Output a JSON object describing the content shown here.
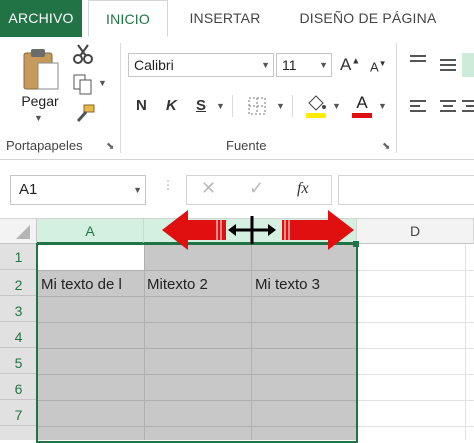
{
  "tabs": {
    "file": "ARCHIVO",
    "home": "INICIO",
    "insert": "INSERTAR",
    "page_layout": "DISEÑO DE PÁGINA"
  },
  "clipboard": {
    "paste_label": "Pegar",
    "group_label": "Portapapeles"
  },
  "font": {
    "name": "Calibri",
    "size": "11",
    "bold": "N",
    "italic": "K",
    "underline": "S",
    "grow": "A",
    "shrink": "A",
    "color_letter": "A",
    "group_label": "Fuente"
  },
  "formula_bar": {
    "name_box": "A1",
    "fx": "fx",
    "value": ""
  },
  "grid": {
    "columns": [
      "A",
      "",
      "",
      "D"
    ],
    "rows": [
      "1",
      "2",
      "3",
      "4",
      "5",
      "6",
      "7"
    ],
    "cells": {
      "a2": "Mi texto de l",
      "b2": "Mitexto 2",
      "c2": "Mi texto 3"
    }
  },
  "colors": {
    "excel_green": "#217346",
    "selection_gray": "#c8c8c8",
    "arrow_red": "#e01010",
    "header_selected": "#d3f0e0"
  },
  "icons": [
    "scissors-icon",
    "copy-icon",
    "format-painter-icon",
    "resize-cursor-icon",
    "resize-left-arrow-icon",
    "resize-right-arrow-icon"
  ]
}
